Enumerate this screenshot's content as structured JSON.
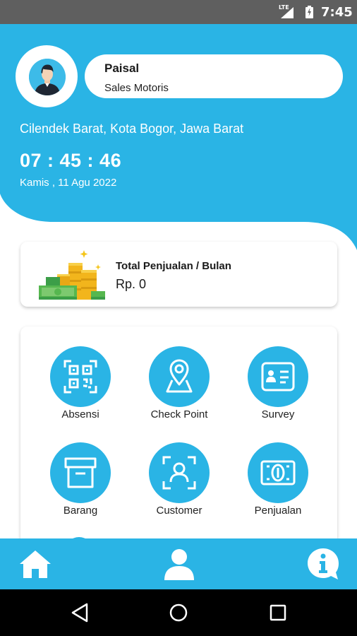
{
  "status_bar": {
    "network": "LTE",
    "time": "7:45"
  },
  "profile": {
    "name": "Paisal",
    "role": "Sales Motoris",
    "avatar_icon": "user-avatar"
  },
  "location": "Cilendek Barat, Kota Bogor, Jawa Barat",
  "clock": "07 : 45 : 46",
  "date": "Kamis , 11 Agu 2022",
  "sales": {
    "title": "Total Penjualan / Bulan",
    "value": "Rp. 0",
    "image_icon": "money-stack"
  },
  "menu": {
    "items": [
      {
        "label": "Absensi",
        "icon": "qr-code-icon"
      },
      {
        "label": "Check Point",
        "icon": "map-pin-icon"
      },
      {
        "label": "Survey",
        "icon": "id-card-icon"
      },
      {
        "label": "Barang",
        "icon": "archive-box-icon"
      },
      {
        "label": "Customer",
        "icon": "user-scan-icon"
      },
      {
        "label": "Penjualan",
        "icon": "banknote-icon"
      }
    ]
  },
  "bottom_nav": {
    "items": [
      {
        "icon": "home-icon"
      },
      {
        "icon": "profile-icon"
      },
      {
        "icon": "info-icon"
      }
    ]
  },
  "colors": {
    "primary": "#2ab4e5",
    "status_bar": "#5f5f5f",
    "text_dark": "#1a1a1a"
  }
}
